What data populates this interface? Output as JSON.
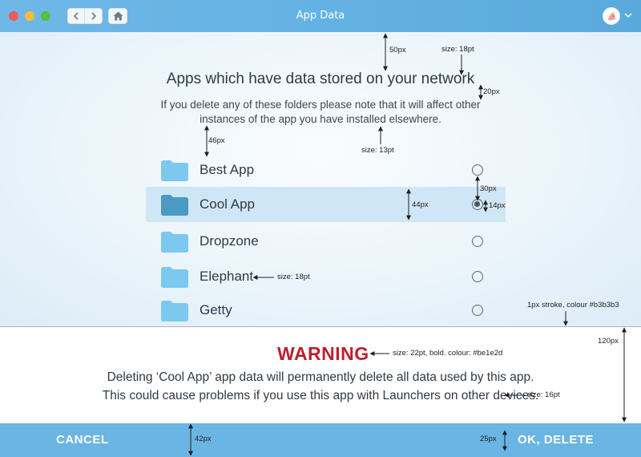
{
  "window": {
    "title": "App Data",
    "controls": [
      "close",
      "minimize",
      "maximize"
    ],
    "nav": {
      "back_icon": "chevron-left-icon",
      "forward_icon": "chevron-right-icon",
      "home_icon": "home-icon"
    },
    "account_caret_icon": "chevron-down-icon"
  },
  "main": {
    "heading": "Apps which have data stored on your network",
    "description": "If you delete any of these folders please note that it will affect other instances of the app you have installed elsewhere.",
    "apps": [
      {
        "label": "Best App",
        "selected": false
      },
      {
        "label": "Cool App",
        "selected": true
      },
      {
        "label": "Dropzone",
        "selected": false
      },
      {
        "label": "Elephant",
        "selected": false
      },
      {
        "label": "Getty",
        "selected": false
      }
    ]
  },
  "annotations": {
    "a50": "50px",
    "a18": "size: 18pt",
    "a20": "20px",
    "a46": "46px",
    "a13": "size: 13pt",
    "a30": "30px",
    "a44": "44px",
    "a14": "14px",
    "a18b": "size: 18pt",
    "stroke": "1px stroke, colour #b3b3b3",
    "a120": "120px",
    "warning_spec": "size: 22pt, bold. colour: #be1e2d",
    "a16": "size: 16pt",
    "a42": "42px",
    "a25": "25px"
  },
  "warning": {
    "title": "WARNING",
    "line1": "Deleting ‘Cool App’ app data will permanently delete all data used by this app.",
    "line2": "This could cause problems if you use this app with Launchers on other devices."
  },
  "footer": {
    "cancel_label": "CANCEL",
    "ok_label": "OK, DELETE"
  },
  "colors": {
    "accent": "#6ab5e3",
    "warning": "#be1e2d",
    "separator": "#b3b3b3",
    "folder": "#7cc8ee",
    "folder_selected": "#4a9ac4",
    "selected_row": "#cfe6f6"
  }
}
